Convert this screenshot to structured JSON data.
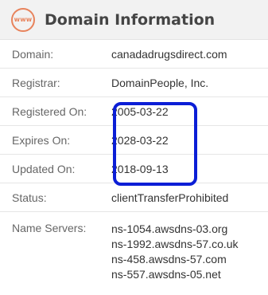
{
  "header": {
    "icon_text": "www",
    "title": "Domain Information"
  },
  "rows": [
    {
      "label": "Domain:",
      "value": "canadadrugsdirect.com"
    },
    {
      "label": "Registrar:",
      "value": "DomainPeople, Inc."
    },
    {
      "label": "Registered On:",
      "value": "2005-03-22"
    },
    {
      "label": "Expires On:",
      "value": "2028-03-22"
    },
    {
      "label": "Updated On:",
      "value": "2018-09-13"
    },
    {
      "label": "Status:",
      "value": "clientTransferProhibited"
    }
  ],
  "name_servers": {
    "label": "Name Servers:",
    "values": [
      "ns-1054.awsdns-03.org",
      "ns-1992.awsdns-57.co.uk",
      "ns-458.awsdns-57.com",
      "ns-557.awsdns-05.net"
    ]
  },
  "colors": {
    "icon_accent": "#e8835c",
    "highlight_border": "#0b1ed6"
  }
}
